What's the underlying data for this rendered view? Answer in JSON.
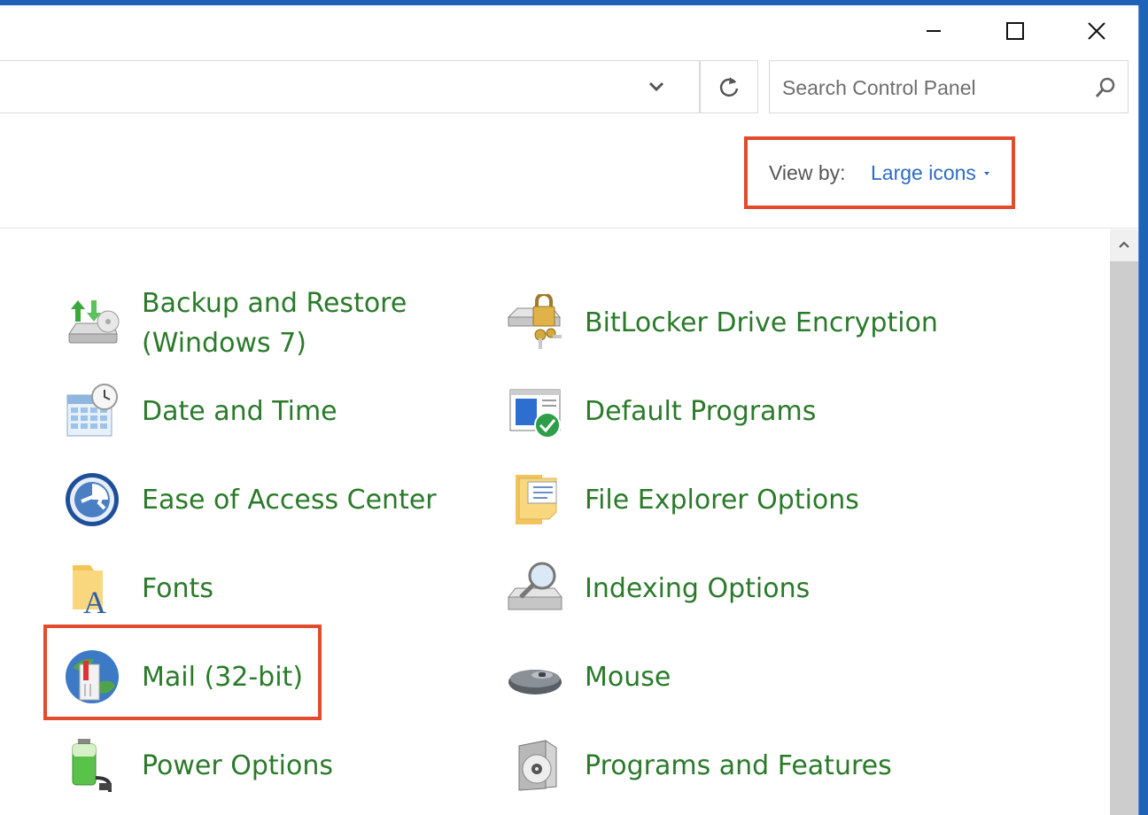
{
  "window": {
    "minimize_icon": "minimize-icon",
    "maximize_icon": "maximize-icon",
    "close_icon": "close-icon"
  },
  "address_bar": {
    "dropdown_icon": "chevron-down-icon",
    "refresh_icon": "refresh-icon"
  },
  "search": {
    "placeholder": "Search Control Panel",
    "icon": "search-icon"
  },
  "view_by": {
    "label": "View by:",
    "value": "Large icons"
  },
  "colors": {
    "link_green": "#2a7a2a",
    "accent_blue": "#2d6cc4",
    "highlight_red": "#e24b2c"
  },
  "items": [
    {
      "label": "Backup and Restore (Windows 7)",
      "icon": "backup-restore-icon"
    },
    {
      "label": "BitLocker Drive Encryption",
      "icon": "bitlocker-icon"
    },
    {
      "label": "Date and Time",
      "icon": "date-time-icon"
    },
    {
      "label": "Default Programs",
      "icon": "default-programs-icon"
    },
    {
      "label": "Ease of Access Center",
      "icon": "ease-of-access-icon"
    },
    {
      "label": "File Explorer Options",
      "icon": "file-explorer-options-icon"
    },
    {
      "label": "Fonts",
      "icon": "fonts-icon"
    },
    {
      "label": "Indexing Options",
      "icon": "indexing-options-icon"
    },
    {
      "label": "Mail (32-bit)",
      "icon": "mail-icon"
    },
    {
      "label": "Mouse",
      "icon": "mouse-icon"
    },
    {
      "label": "Power Options",
      "icon": "power-options-icon"
    },
    {
      "label": "Programs and Features",
      "icon": "programs-features-icon"
    }
  ]
}
